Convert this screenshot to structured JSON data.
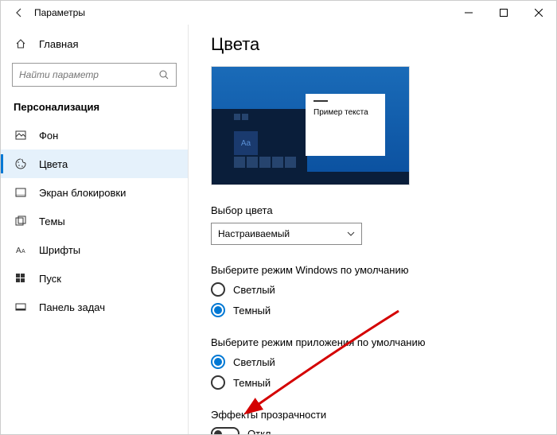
{
  "window": {
    "title": "Параметры"
  },
  "sidebar": {
    "home": "Главная",
    "search_placeholder": "Найти параметр",
    "section": "Персонализация",
    "items": [
      {
        "label": "Фон"
      },
      {
        "label": "Цвета"
      },
      {
        "label": "Экран блокировки"
      },
      {
        "label": "Темы"
      },
      {
        "label": "Шрифты"
      },
      {
        "label": "Пуск"
      },
      {
        "label": "Панель задач"
      }
    ]
  },
  "content": {
    "heading": "Цвета",
    "preview_sample": "Пример текста",
    "preview_aa": "Aa",
    "color_choice_label": "Выбор цвета",
    "color_choice_value": "Настраиваемый",
    "windows_mode_label": "Выберите режим Windows по умолчанию",
    "windows_mode_light": "Светлый",
    "windows_mode_dark": "Темный",
    "app_mode_label": "Выберите режим приложения по умолчанию",
    "app_mode_light": "Светлый",
    "app_mode_dark": "Темный",
    "transparency_label": "Эффекты прозрачности",
    "transparency_state": "Откл."
  }
}
